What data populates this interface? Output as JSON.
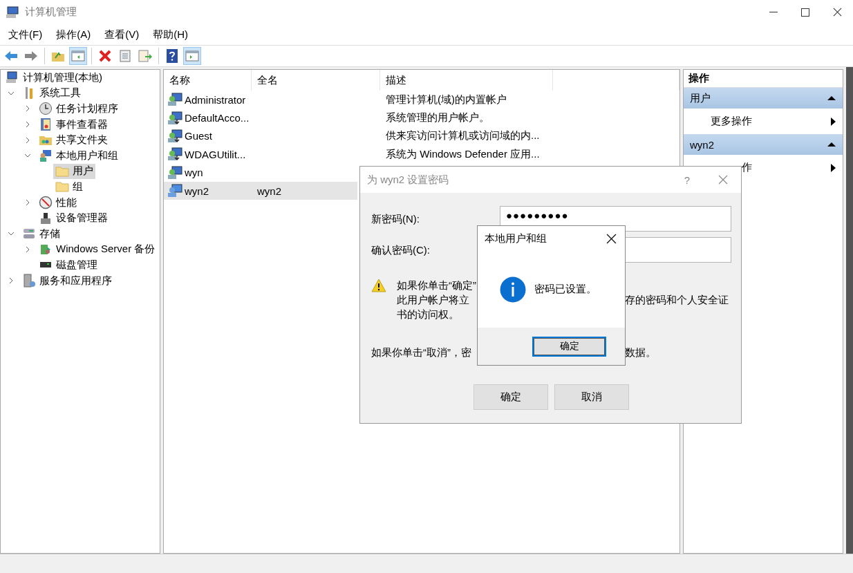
{
  "window": {
    "title": "计算机管理"
  },
  "menu": [
    "文件(F)",
    "操作(A)",
    "查看(V)",
    "帮助(H)"
  ],
  "toolbar": [
    {
      "kind": "back",
      "pressed": false
    },
    {
      "kind": "forward",
      "pressed": false
    },
    {
      "kind": "separator"
    },
    {
      "kind": "up",
      "pressed": false
    },
    {
      "kind": "tree",
      "pressed": true
    },
    {
      "kind": "separator"
    },
    {
      "kind": "delete",
      "pressed": false
    },
    {
      "kind": "properties",
      "pressed": false
    },
    {
      "kind": "export",
      "pressed": false
    },
    {
      "kind": "separator"
    },
    {
      "kind": "help",
      "pressed": false
    },
    {
      "kind": "actions",
      "pressed": true
    }
  ],
  "tree": [
    {
      "label": "计算机管理(本地)",
      "selected": false,
      "children": [
        {
          "label": "系统工具",
          "selected": false,
          "expanded": true,
          "children": [
            {
              "label": "任务计划程序",
              "selected": false,
              "expanded": false
            },
            {
              "label": "事件查看器",
              "selected": false,
              "expanded": false
            },
            {
              "label": "共享文件夹",
              "selected": false,
              "expanded": false
            },
            {
              "label": "本地用户和组",
              "selected": false,
              "expanded": true,
              "children": [
                {
                  "label": "用户",
                  "selected": true
                },
                {
                  "label": "组",
                  "selected": false
                }
              ]
            },
            {
              "label": "性能",
              "selected": false,
              "expanded": false
            },
            {
              "label": "设备管理器",
              "selected": false
            }
          ]
        },
        {
          "label": "存储",
          "selected": false,
          "expanded": true,
          "children": [
            {
              "label": "Windows Server 备份",
              "selected": false,
              "expanded": false
            },
            {
              "label": "磁盘管理",
              "selected": false
            }
          ]
        },
        {
          "label": "服务和应用程序",
          "selected": false,
          "expanded": false
        }
      ]
    }
  ],
  "list": {
    "columns": [
      "名称",
      "全名",
      "描述"
    ],
    "rows": [
      {
        "name": "Administrator",
        "full_name": "",
        "description": "管理计算机(域)的内置帐户",
        "disabled": false,
        "selected": false
      },
      {
        "name": "DefaultAcco...",
        "full_name": "",
        "description": "系统管理的用户帐户。",
        "disabled": true,
        "selected": false
      },
      {
        "name": "Guest",
        "full_name": "",
        "description": "供来宾访问计算机或访问域的内...",
        "disabled": true,
        "selected": false
      },
      {
        "name": "WDAGUtilit...",
        "full_name": "",
        "description": "系统为 Windows Defender 应用...",
        "disabled": true,
        "selected": false
      },
      {
        "name": "wyn",
        "full_name": "",
        "description": "",
        "disabled": false,
        "selected": false
      },
      {
        "name": "wyn2",
        "full_name": "wyn2",
        "description": "",
        "disabled": false,
        "selected": true
      }
    ]
  },
  "actions": {
    "title": "操作",
    "sections": [
      {
        "title": "用户",
        "expanded": true,
        "items": [
          "更多操作"
        ]
      },
      {
        "title": "wyn2",
        "expanded": true,
        "items": [
          "作"
        ]
      }
    ]
  },
  "password_dialog": {
    "title": "为 wyn2 设置密码",
    "help": "?",
    "fields": [
      {
        "label": "新密码(N):",
        "value": "●●●●●●●●●"
      },
      {
        "label": "确认密码(C):"
      }
    ],
    "warning_lines": [
      [
        "如果你单击“确定”"
      ],
      [
        "此用户帐户将立",
        "存的密码和个人安全证"
      ],
      [
        "书的访问权。"
      ]
    ],
    "note": [
      "如果你单击“取消”，密",
      "数据。"
    ],
    "buttons": [
      "确定",
      "取消"
    ]
  },
  "message_box": {
    "title": "本地用户和组",
    "message": "密码已设置。",
    "button": "确定"
  }
}
